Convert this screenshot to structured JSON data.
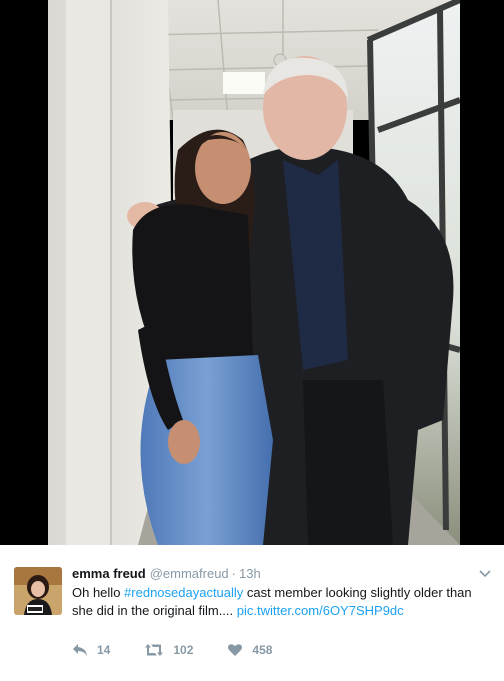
{
  "tweet": {
    "name": "emma freud",
    "handle": "@emmafreud",
    "separator": "·",
    "time": "13h",
    "text_before": "Oh hello ",
    "hashtag": "#rednosedayactually",
    "text_after": " cast member looking slightly older than she did in the original film.... ",
    "pic_link": "pic.twitter.com/6OY7SHP9dc"
  },
  "actions": {
    "reply_count": "14",
    "retweet_count": "102",
    "like_count": "458"
  },
  "icons": {
    "reply": "reply-icon",
    "retweet": "retweet-icon",
    "like": "heart-icon",
    "menu": "chevron-down-icon"
  },
  "colors": {
    "link": "#1da1f2",
    "meta": "#8899a6",
    "text": "#14171a"
  }
}
